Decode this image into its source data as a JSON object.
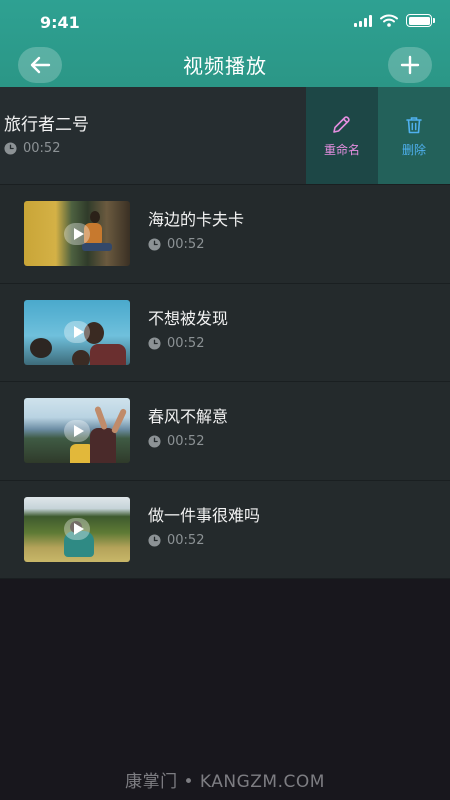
{
  "status_bar": {
    "time": "9:41"
  },
  "nav": {
    "title": "视频播放",
    "back_icon": "arrow-left-icon",
    "add_icon": "plus-icon"
  },
  "swiped_item": {
    "title": "旅行者二号",
    "duration": "00:52",
    "actions": {
      "rename_label": "重命名",
      "delete_label": "删除"
    }
  },
  "videos": [
    {
      "title": "海边的卡夫卡",
      "duration": "00:52"
    },
    {
      "title": "不想被发现",
      "duration": "00:52"
    },
    {
      "title": "春风不解意",
      "duration": "00:52"
    },
    {
      "title": "做一件事很难吗",
      "duration": "00:52"
    }
  ],
  "colors": {
    "accent": "#2a9d8f",
    "rename": "#e48ee0",
    "delete": "#4fb0ee",
    "background": "#18171d",
    "row": "#242a2c"
  },
  "watermark": "康掌门 • KANGZM.COM"
}
